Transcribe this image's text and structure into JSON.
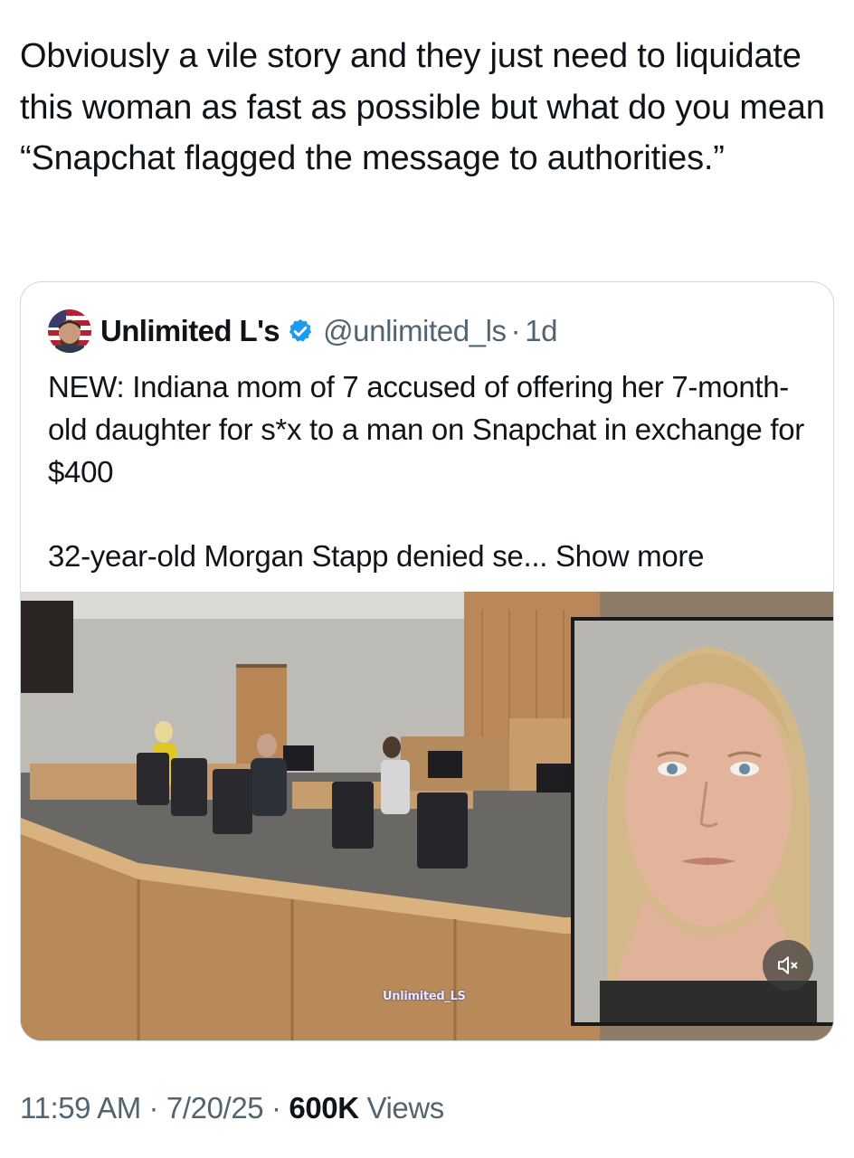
{
  "post": {
    "text": "Obviously a vile story and they just need to liquidate this woman as fast as possible but what do you mean “Snapchat flagged the message to authorities.”"
  },
  "quote": {
    "author_name": "Unlimited L's",
    "handle": "@unlimited_ls",
    "separator": "·",
    "age": "1d",
    "body": "NEW: Indiana mom of 7 accused of offering her 7-month-old daughter for s*x to a man on Snapchat in exchange for $400",
    "body2": "32-year-old Morgan Stapp denied se...",
    "show_more": "Show more",
    "watermark": "Unlimited_LS"
  },
  "meta": {
    "time": "11:59 AM",
    "sep1": " · ",
    "date": "7/20/25",
    "sep2": " · ",
    "views_count": "600K",
    "views_label": " Views"
  },
  "icons": {
    "verified": "verified-badge-icon",
    "mute": "volume-muted-icon"
  },
  "colors": {
    "verified_blue": "#1d9bf0",
    "secondary_text": "#536471",
    "border": "#cfd9de"
  }
}
